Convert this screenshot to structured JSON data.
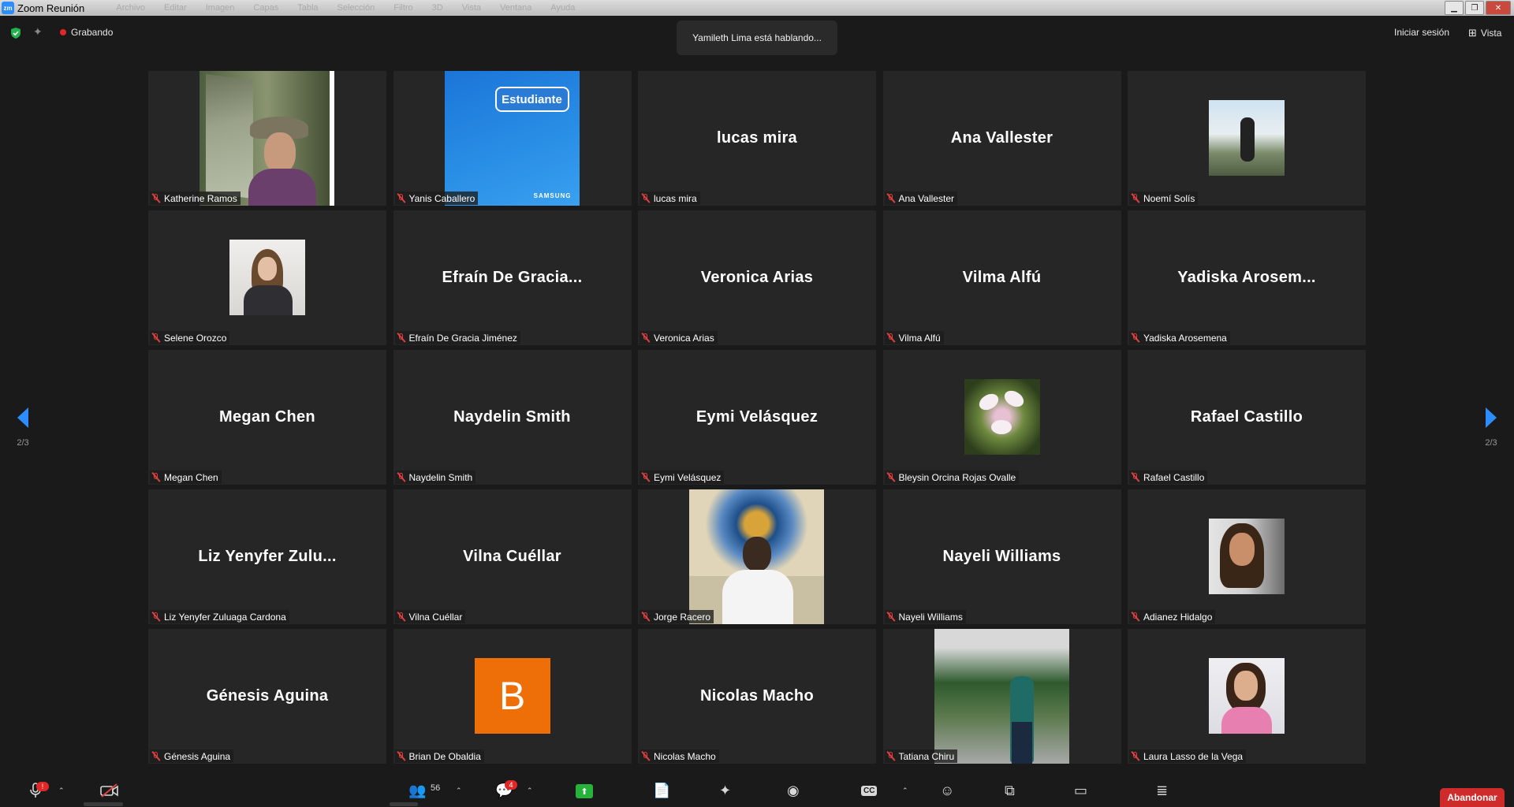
{
  "window": {
    "title": "Zoom Reunión",
    "app_icon": "zm",
    "menu_ghost": [
      "Archivo",
      "Editar",
      "Imagen",
      "Capas",
      "Tabla",
      "Selección",
      "Filtro",
      "3D",
      "Vista",
      "Ventana",
      "Ayuda"
    ]
  },
  "topbar": {
    "recording_label": "Grabando",
    "speaking_banner": "Yamileth Lima está hablando...",
    "signin_label": "Iniciar sesión",
    "view_label": "Vista"
  },
  "pager": {
    "left": "2/3",
    "right": "2/3"
  },
  "tiles": [
    {
      "name": "Katherine Ramos",
      "display": "photo",
      "photo": "katherine"
    },
    {
      "name": "Yanis Caballero",
      "display": "photo",
      "photo": "yanis",
      "photo_text": "Estudiante",
      "photo_brand": "SAMSUNG"
    },
    {
      "name": "lucas mira",
      "display": "name",
      "big": "lucas mira"
    },
    {
      "name": "Ana Vallester",
      "display": "name",
      "big": "Ana Vallester"
    },
    {
      "name": "Noemí Solís",
      "display": "photo",
      "photo": "noemi"
    },
    {
      "name": "Selene Orozco",
      "display": "photo",
      "photo": "selene"
    },
    {
      "name": "Efraín De Gracia Jiménez",
      "display": "name",
      "big": "Efraín De Gracia..."
    },
    {
      "name": "Veronica Arias",
      "display": "name",
      "big": "Veronica Arias"
    },
    {
      "name": "Vilma Alfú",
      "display": "name",
      "big": "Vilma Alfú"
    },
    {
      "name": "Yadiska Arosemena",
      "display": "name",
      "big": "Yadiska Arosem..."
    },
    {
      "name": "Megan Chen",
      "display": "name",
      "big": "Megan Chen"
    },
    {
      "name": "Naydelin Smith",
      "display": "name",
      "big": "Naydelin Smith"
    },
    {
      "name": "Eymi Velásquez",
      "display": "name",
      "big": "Eymi Velásquez"
    },
    {
      "name": "Bleysin Orcina Rojas Ovalle",
      "display": "photo",
      "photo": "flower"
    },
    {
      "name": "Rafael Castillo",
      "display": "name",
      "big": "Rafael Castillo"
    },
    {
      "name": "Liz Yenyfer Zuluaga Cardona",
      "display": "name",
      "big": "Liz Yenyfer Zulu..."
    },
    {
      "name": "Vilna Cuéllar",
      "display": "name",
      "big": "Vilna Cuéllar"
    },
    {
      "name": "Jorge Racero",
      "display": "photo",
      "photo": "jorge"
    },
    {
      "name": "Nayeli Williams",
      "display": "name",
      "big": "Nayeli Williams"
    },
    {
      "name": "Adianez Hidalgo",
      "display": "photo",
      "photo": "adianez"
    },
    {
      "name": "Génesis Aguina",
      "display": "name",
      "big": "Génesis Aguina"
    },
    {
      "name": "Brian De Obaldia",
      "display": "initial",
      "big": "B"
    },
    {
      "name": "Nicolas Macho",
      "display": "name",
      "big": "Nicolas Macho"
    },
    {
      "name": "Tatiana Chiru",
      "display": "photo",
      "photo": "tatiana"
    },
    {
      "name": "Laura Lasso de la Vega",
      "display": "photo",
      "photo": "laura"
    }
  ],
  "toolbar": {
    "audio_alert": "!",
    "participants_count": "56",
    "chat_badge": "4",
    "leave_label": "Abandonar"
  },
  "colors": {
    "accent": "#2d8cff",
    "leave": "#d02b2b",
    "mic_muted": "#e04040",
    "share": "#25b33a",
    "initial_tile": "#ee6f07"
  }
}
